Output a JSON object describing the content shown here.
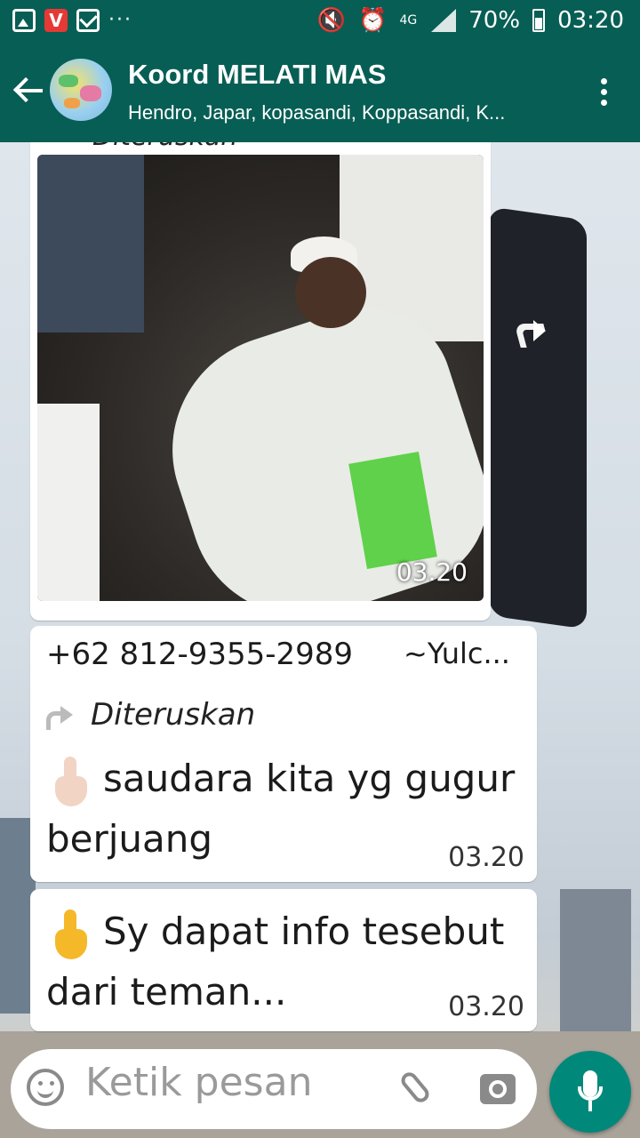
{
  "status_bar": {
    "battery": "70%",
    "time": "03:20",
    "network": "4G",
    "more": "···"
  },
  "header": {
    "title": "Koord MELATI MAS",
    "subtitle": "Hendro, Japar, kopasandi, Koppasandi, K..."
  },
  "messages": [
    {
      "type": "image",
      "forwarded_label": "Diteruskan",
      "time": "03.20"
    },
    {
      "type": "text",
      "sender_phone": "+62 812-9355-2989",
      "sender_name": "~Yulc...",
      "forwarded_label": "Diteruskan",
      "text_line1": "saudara kita yg gugur",
      "text_line2": "berjuang",
      "time": "03.20"
    },
    {
      "type": "text",
      "text_line1": "Sy dapat info tesebut",
      "text_line2": "dari teman...",
      "time": "03.20"
    }
  ],
  "input": {
    "placeholder": "Ketik pesan"
  },
  "colors": {
    "header": "#075e54",
    "mic_button": "#00897b",
    "bubble": "#ffffff"
  }
}
